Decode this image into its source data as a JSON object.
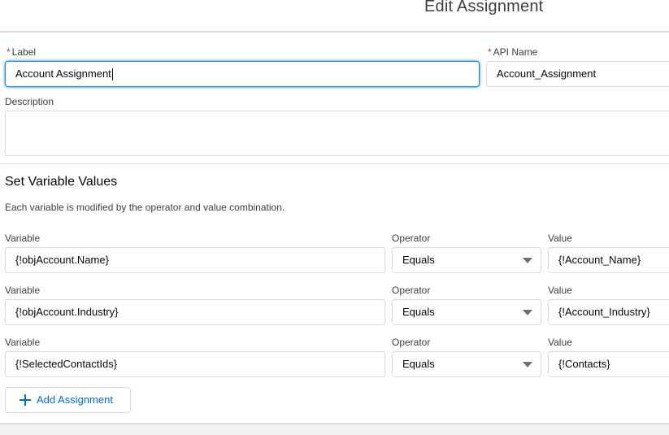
{
  "modal": {
    "title": "Edit Assignment"
  },
  "form": {
    "label": {
      "label": "Label",
      "value": "Account Assignment"
    },
    "api_name": {
      "label": "API Name",
      "value": "Account_Assignment"
    },
    "description": {
      "label": "Description",
      "value": ""
    },
    "required_marker": "*"
  },
  "variables_section": {
    "title": "Set Variable Values",
    "description": "Each variable is modified by the operator and value combination.",
    "column_labels": {
      "variable": "Variable",
      "operator": "Operator",
      "value": "Value"
    },
    "rows": [
      {
        "variable": "{!objAccount.Name}",
        "operator": "Equals",
        "value": "{!Account_Name}"
      },
      {
        "variable": "{!objAccount.Industry}",
        "operator": "Equals",
        "value": "{!Account_Industry}"
      },
      {
        "variable": "{!SelectedContactIds}",
        "operator": "Equals",
        "value": "{!Contacts}"
      }
    ],
    "add_button_label": "Add Assignment"
  },
  "icons": {
    "add": "plus-icon",
    "dropdown": "chevron-down-icon"
  },
  "colors": {
    "focus_border": "#1589ee",
    "link_blue": "#0070d2",
    "required_red": "#c23934",
    "border": "#dddbda"
  }
}
